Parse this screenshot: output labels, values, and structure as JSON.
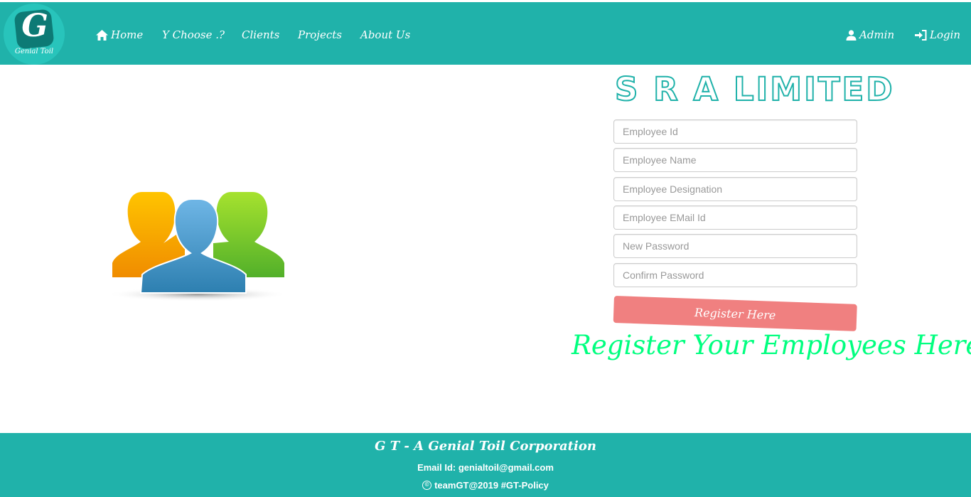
{
  "brand": {
    "logo_letter": "G",
    "logo_name": "Genial Toil",
    "title": "S R A LIMITED"
  },
  "nav": {
    "home": "Home",
    "why": "Y Choose .?",
    "clients": "Clients",
    "projects": "Projects",
    "about": "About Us",
    "admin": "Admin",
    "login": "Login"
  },
  "form": {
    "employee_id": {
      "placeholder": "Employee Id",
      "value": ""
    },
    "employee_name": {
      "placeholder": "Employee Name",
      "value": ""
    },
    "employee_designation": {
      "placeholder": "Employee Designation",
      "value": ""
    },
    "employee_email": {
      "placeholder": "Employee EMail Id",
      "value": ""
    },
    "new_password": {
      "placeholder": "New Password",
      "value": ""
    },
    "confirm_password": {
      "placeholder": "Confirm Password",
      "value": ""
    },
    "submit_label": "Register Here"
  },
  "tagline": "Register Your Employees Here",
  "footer": {
    "title": "G T - A Genial Toil Corporation",
    "email": "Email Id: genialtoil@gmail.com",
    "copyright": "teamGT@2019 #GT-Policy"
  },
  "icons": {
    "home": "home-icon",
    "admin": "user-icon",
    "login": "login-icon",
    "copyright": "copyright-icon",
    "illustration": "users-group-icon"
  },
  "colors": {
    "primary": "#20b2aa",
    "button": "#f08080",
    "tagline": "#00ff7f"
  }
}
